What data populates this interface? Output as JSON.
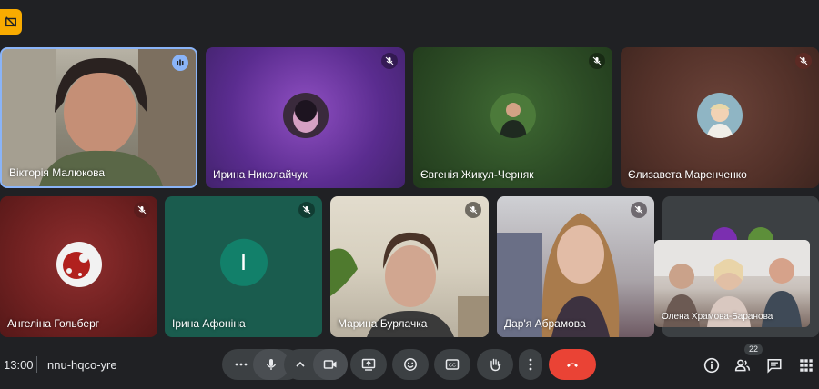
{
  "colors": {
    "background": "#202124",
    "active_speaker_border": "#8ab4f8",
    "end_call": "#ea4335",
    "control_bg": "#3c4043",
    "badge": "#f9ab00"
  },
  "meeting": {
    "time": "13:00",
    "code": "nnu-hqco-yre",
    "participant_count": "22"
  },
  "tiles": [
    {
      "name": "Вікторія Малюкова",
      "state": "speaking",
      "icon": "audio-level-icon"
    },
    {
      "name": "Ирина Николайчук",
      "state": "muted",
      "icon": "mic-off-icon"
    },
    {
      "name": "Євгенія Жикул-Черняк",
      "state": "muted",
      "icon": "mic-off-icon"
    },
    {
      "name": "Єлизавета Маренченко",
      "state": "muted",
      "icon": "mic-off-icon"
    },
    {
      "name": "Ангеліна Гольберг",
      "state": "muted",
      "icon": "mic-off-icon"
    },
    {
      "name": "Ірина Афоніна",
      "state": "muted",
      "icon": "mic-off-icon",
      "avatar_letter": "I"
    },
    {
      "name": "Марина Бурлачка",
      "state": "muted",
      "icon": "mic-off-icon"
    },
    {
      "name": "Дар'я Абрамова",
      "state": "muted",
      "icon": "mic-off-icon"
    }
  ],
  "self_view": {
    "name": "Олена Храмова-Баранова"
  },
  "controls": [
    {
      "name": "more-options",
      "icon": "ellipsis-icon"
    },
    {
      "name": "microphone",
      "icon": "mic-icon"
    },
    {
      "name": "camera-options",
      "icon": "chevron-up-icon"
    },
    {
      "name": "camera",
      "icon": "camera-icon"
    },
    {
      "name": "present",
      "icon": "present-icon"
    },
    {
      "name": "reactions",
      "icon": "emoji-icon"
    },
    {
      "name": "captions",
      "icon": "cc-icon"
    },
    {
      "name": "raise-hand",
      "icon": "hand-icon"
    },
    {
      "name": "more",
      "icon": "vertical-dots-icon"
    },
    {
      "name": "leave-call",
      "icon": "hangup-icon"
    }
  ],
  "right_controls": [
    {
      "name": "meeting-details",
      "icon": "info-icon"
    },
    {
      "name": "people",
      "icon": "people-icon"
    },
    {
      "name": "chat",
      "icon": "chat-icon"
    },
    {
      "name": "activities",
      "icon": "apps-grid-icon"
    }
  ]
}
